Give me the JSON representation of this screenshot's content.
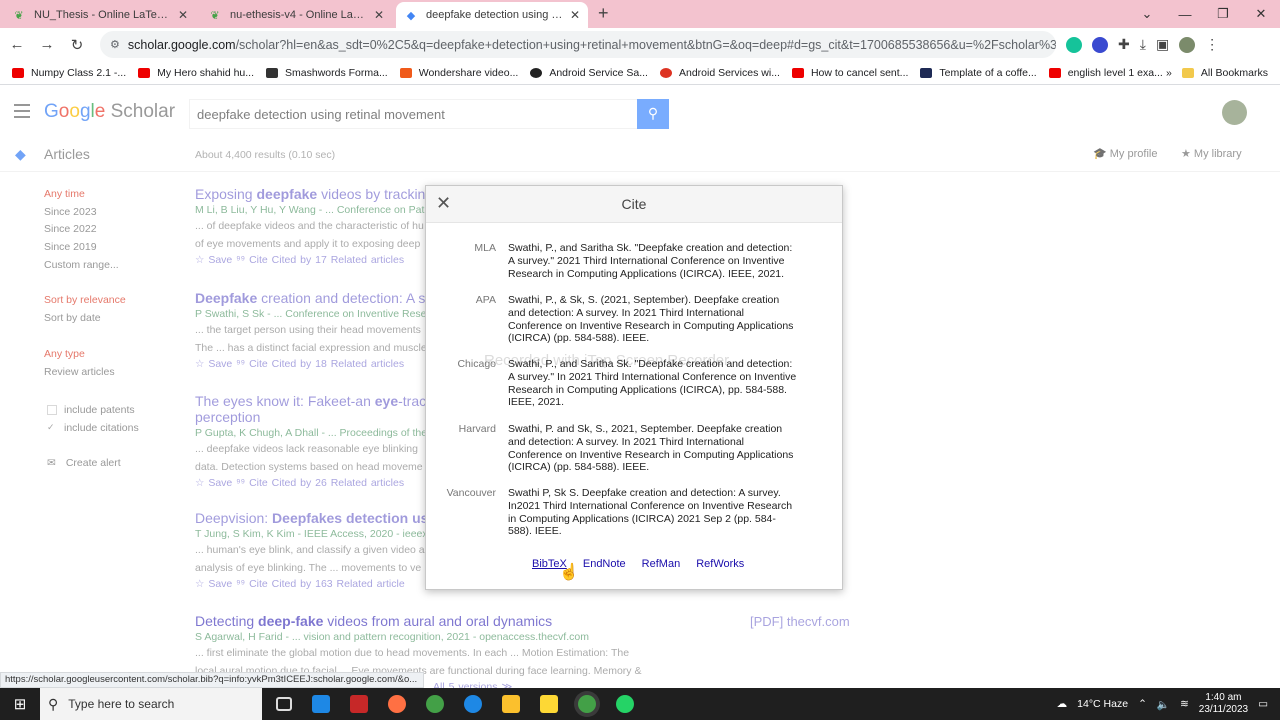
{
  "browser": {
    "tabs": [
      {
        "title": "NU_Thesis - Online LaTeX Editor",
        "active": false
      },
      {
        "title": "nu-ethesis-v4 - Online LaTeX Edi",
        "active": false
      },
      {
        "title": "deepfake detection using retina",
        "active": true
      }
    ],
    "url_host": "scholar.google.com",
    "url_path": "/scholar?hl=en&as_sdt=0%2C5&q=deepfake+detection+using+retinal+movement&btnG=&oq=deep#d=gs_cit&t=1700685538656&u=%2Fscholar%3Fq%3Dinfo%...",
    "bookmarks": [
      "Numpy Class 2.1 -...",
      "My Hero shahid hu...",
      "Smashwords Forma...",
      "Wondershare video...",
      "Android Service Sa...",
      "Android Services wi...",
      "How to cancel sent...",
      "Template of a coffe...",
      "english level 1 exa..."
    ],
    "all_bookmarks": "All Bookmarks",
    "status_url": "https://scholar.googleusercontent.com/scholar.bib?q=info:yvkPm3tICEEJ:scholar.google.com/&o..."
  },
  "scholar": {
    "logo_google": "Google",
    "logo_scholar": "Scholar",
    "query": "deepfake detection using retinal movement",
    "articles": "Articles",
    "result_count": "About 4,400 results (0.10 sec)",
    "my_profile": "My profile",
    "my_library": "My library",
    "side": {
      "any_time": "Any time",
      "since_2023": "Since 2023",
      "since_2022": "Since 2022",
      "since_2019": "Since 2019",
      "custom_range": "Custom range...",
      "sort_relevance": "Sort by relevance",
      "sort_date": "Sort by date",
      "any_type": "Any type",
      "review_articles": "Review articles",
      "include_patents": "include patents",
      "include_citations": "include citations",
      "create_alert": "Create alert"
    },
    "results": [
      {
        "title_pre": "Exposing ",
        "title_b": "deepfake",
        "title_post": " videos by tracking",
        "authors": "M Li, B Liu, Y Hu, Y Wang - ... Conference on Pat",
        "snippet1": "... of deepfake videos and the characteristic of hu",
        "snippet2": "of eye movements and apply it to exposing deep",
        "actions": "☆ Save   ⁹⁹ Cite   Cited by 17   Related articles"
      },
      {
        "title_pre": "",
        "title_b": "Deepfake",
        "title_post": " creation and detection: A s",
        "authors": "P Swathi, S Sk - ... Conference on Inventive Resea",
        "snippet1": "... the target person using their head movements",
        "snippet2": "The ... has a distinct facial expression and muscle",
        "actions": "☆ Save   ⁹⁹ Cite   Cited by 18   Related articles"
      },
      {
        "title_pre": "The eyes know it: Fakeet-an ",
        "title_b": "eye",
        "title_post": "-track",
        "title2": "perception",
        "authors": "P Gupta, K Chugh, A Dhall - ... Proceedings of the",
        "snippet1": "... deepfake videos lack reasonable eye blinking",
        "snippet2": "data. Detection systems based on head moveme",
        "actions": "☆ Save   ⁹⁹ Cite   Cited by 26   Related articles"
      },
      {
        "title_pre": "Deepvision: ",
        "title_b": "Deepfakes detection usi",
        "title_post": "",
        "authors": "T Jung, S Kim, K Kim - IEEE Access, 2020 - ieeex",
        "snippet1": "... human's eye blink, and classify a given video a",
        "snippet2": "analysis of eye blinking. The ... movements to ve",
        "actions": "☆ Save   ⁹⁹ Cite   Cited by 163   Related article"
      },
      {
        "title_pre": "Detecting ",
        "title_b": "deep-fake",
        "title_post": " videos from aural and oral dynamics",
        "authors": "S Agarwal, H Farid - ... vision and pattern recognition, 2021 - openaccess.thecvf.com",
        "snippet1": "... first eliminate the global motion due to head movements. In each ... Motion Estimation: The",
        "snippet2": "local aural motion due to facial ... Eye movements are functional during face learning. Memory &",
        "actions": "All 5 versions  ≫"
      }
    ],
    "pdf_link": "[PDF] thecvf.com"
  },
  "cite_modal": {
    "title": "Cite",
    "watermark": "Recorded with iTop Screen Recorder",
    "citations": [
      {
        "style": "MLA",
        "lines": [
          "Swathi, P., and Saritha Sk. \"Deepfake creation and detection:",
          "A survey.\" 2021 Third International Conference on Inventive",
          "Research in Computing Applications (ICIRCA). IEEE, 2021."
        ]
      },
      {
        "style": "APA",
        "lines": [
          "Swathi, P., & Sk, S. (2021, September). Deepfake creation",
          "and detection: A survey. In 2021 Third International",
          "Conference on Inventive Research in Computing Applications",
          "(ICIRCA) (pp. 584-588). IEEE."
        ]
      },
      {
        "style": "Chicago",
        "lines": [
          "Swathi, P., and Saritha Sk. \"Deepfake creation and detection:",
          "A survey.\" In 2021 Third International Conference on Inventive",
          "Research in Computing Applications (ICIRCA), pp. 584-588.",
          "IEEE, 2021."
        ]
      },
      {
        "style": "Harvard",
        "lines": [
          "Swathi, P. and Sk, S., 2021, September. Deepfake creation",
          "and detection: A survey. In 2021 Third International",
          "Conference on Inventive Research in Computing Applications",
          "(ICIRCA) (pp. 584-588). IEEE."
        ]
      },
      {
        "style": "Vancouver",
        "lines": [
          "Swathi P, Sk S. Deepfake creation and detection: A survey.",
          "In2021 Third International Conference on Inventive Research",
          "in Computing Applications (ICIRCA) 2021 Sep 2 (pp. 584-",
          "588). IEEE."
        ]
      }
    ],
    "exports": [
      "BibTeX",
      "EndNote",
      "RefMan",
      "RefWorks"
    ]
  },
  "taskbar": {
    "search_placeholder": "Type here to search",
    "weather": "14°C  Haze",
    "time": "1:40 am",
    "date": "23/11/2023"
  }
}
